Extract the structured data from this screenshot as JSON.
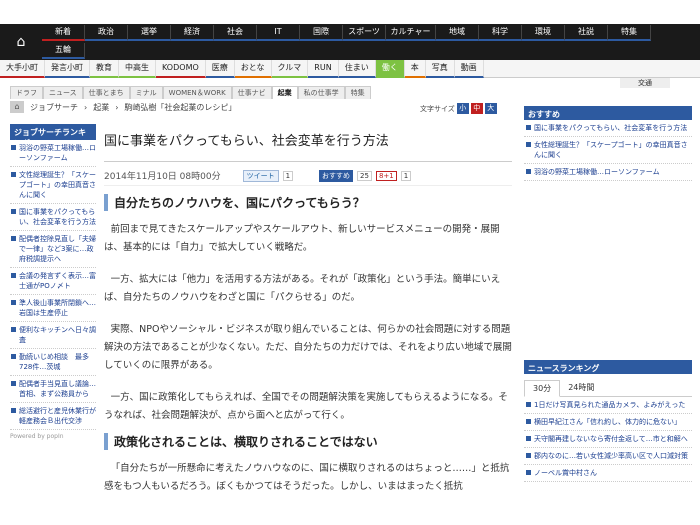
{
  "topnav": {
    "row1": [
      "新着",
      "政治",
      "選挙",
      "経済",
      "社会",
      "IT",
      "国際",
      "スポーツ",
      "カルチャー",
      "地域",
      "科学",
      "環境",
      "社説",
      "特集"
    ],
    "row1_colors": [
      "#c02020",
      "#2d5aa0",
      "#2d5aa0",
      "#2d5aa0",
      "#2d5aa0",
      "#2d5aa0",
      "#2d5aa0",
      "#2d5aa0",
      "#2d5aa0",
      "#2d5aa0",
      "#2d5aa0",
      "#2d5aa0",
      "#2d5aa0",
      "#2d5aa0"
    ],
    "row2": [
      "五輪"
    ]
  },
  "subnav": {
    "items": [
      "大手小町",
      "発言小町",
      "教育",
      "中高生",
      "KODOMO",
      "医療",
      "おとな",
      "クルマ",
      "RUN",
      "住まい",
      "働く",
      "本",
      "写真",
      "動画"
    ],
    "colors": [
      "#c02020",
      "#2d5aa0",
      "#7dc242",
      "#7dc242",
      "#c02020",
      "#2d5aa0",
      "#e07000",
      "#7dc242",
      "#2d5aa0",
      "#2d5aa0",
      "#7dc242",
      "#e07000",
      "#2d5aa0",
      "#2d5aa0"
    ],
    "active_index": 10,
    "extra": "交通"
  },
  "tabs": [
    "ドラフ",
    "ニュース",
    "仕事とまち",
    "ミナル",
    "WOMEN＆WORK",
    "仕事ナビ",
    "起業",
    "私の仕事学",
    "特集"
  ],
  "tabs_active": 6,
  "breadcrumb": [
    "ジョブサーチ",
    "起業",
    "駒崎弘樹「社会起業のレシピ」"
  ],
  "fontsize": {
    "label": "文字サイズ",
    "small": "小",
    "medium": "中",
    "large": "大"
  },
  "left": {
    "heading": "ジョブサーチランキング",
    "items": [
      "羽浴の野菜工場稼働…ローソンファーム",
      "文性総理誕生？「スケープゴート」の幸田真音さんに聞く",
      "国に事業をパクってもらい、社会変革を行う方法",
      "配偶者控除見直し「夫婦で一律」など3案に…政府税調提示へ",
      "会議の発言ずく表示…富士通がPOノ〆ト",
      "準人後山事業所閉鎖へ…岩国は生産停止",
      "便利なキッチンへ日々調査",
      "勤続いじめ相談　最多728件…茨城",
      "配偶者手当見直し議論…首相、まず公務員から",
      "総活避行と産児休業行が軽産務会Ｂ出代交渉"
    ],
    "powered": "Powered by popIn"
  },
  "article": {
    "title": "国に事業をパクってもらい、社会変革を行う方法",
    "date": "2014年11月10日 08時00分",
    "tweet": "ツイート",
    "tweet_count": "1",
    "osusume": "おすすめ",
    "osusume_count": "25",
    "gplus": "8+1",
    "gplus_count": "1",
    "h2_1": "自分たちのノウハウを、国にパクってもらう？",
    "p1": "前回まで見てきたスケールアップやスケールアウト、新しいサービスメニューの開発・展開は、基本的には「自力」で拡大していく戦略だ。",
    "p2": "一方、拡大には「他力」を活用する方法がある。それが「政策化」という手法。簡単にいえば、自分たちのノウハウをわざと国に「パクらせる」のだ。",
    "p3": "実際、NPOやソーシャル・ビジネスが取り組んでいることは、何らかの社会問題に対する問題解決の方法であることが少なくない。ただ、自分たちの力だけでは、それをより広い地域で展開していくのに限界がある。",
    "p4": "一方、国に政策化してもらえれば、全国でその問題解決策を実施してもらえるようになる。そうなれば、社会問題解決が、点から面へと広がって行く。",
    "h2_2": "政策化されることは、横取りされることではない",
    "p5": "「自分たちが一所懸命に考えたノウハウなのに、国に横取りされるのはちょっと……」と抵抗感をもつ人もいるだろう。ぼくもかつてはそうだった。しかし、いまはまったく抵抗"
  },
  "right": {
    "heading": "おすすめ",
    "items": [
      "国に事業をパクってもらい、社会変革を行う方法",
      "女性総理誕生？「スケープゴート」の幸田真音さんに聞く",
      "羽浴の野菜工場稼働…ローソンファーム"
    ],
    "ranking_heading": "ニュースランキング",
    "ranking_tabs": [
      "30分",
      "24時間"
    ],
    "ranking_items": [
      "1日だけ写真見られた通品カメラ、よみがえった",
      "横田早紀江さん「信れ約し、体力的に危ない」",
      "天守閣再建しないなら寄付金返して…市と和解へ",
      "郡内なのに…若い女性減少率高い区で人口減対策",
      "ノーベル賞中村さん"
    ]
  }
}
